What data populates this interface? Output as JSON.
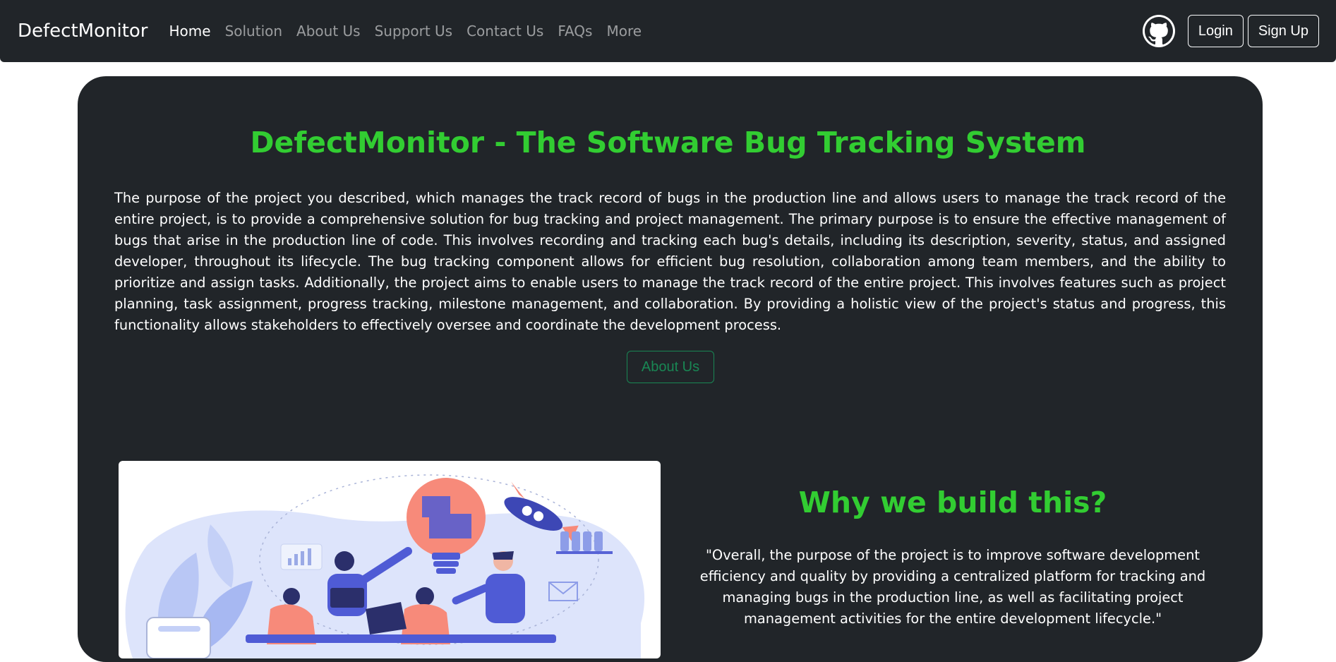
{
  "navbar": {
    "brand": "DefectMonitor",
    "links": [
      {
        "label": "Home",
        "active": true
      },
      {
        "label": "Solution",
        "active": false
      },
      {
        "label": "About Us",
        "active": false
      },
      {
        "label": "Support Us",
        "active": false
      },
      {
        "label": "Contact Us",
        "active": false
      },
      {
        "label": "FAQs",
        "active": false
      },
      {
        "label": "More",
        "active": false
      }
    ],
    "github_icon": "github-icon",
    "login_label": "Login",
    "signup_label": "Sign Up"
  },
  "hero": {
    "title": "DefectMonitor - The Software Bug Tracking System",
    "description": "The purpose of the project you described, which manages the track record of bugs in the production line and allows users to manage the track record of the entire project, is to provide a comprehensive solution for bug tracking and project management. The primary purpose is to ensure the effective management of bugs that arise in the production line of code. This involves recording and tracking each bug's details, including its description, severity, status, and assigned developer, throughout its lifecycle. The bug tracking component allows for efficient bug resolution, collaboration among team members, and the ability to prioritize and assign tasks. Additionally, the project aims to enable users to manage the track record of the entire project. This involves features such as project planning, task assignment, progress tracking, milestone management, and collaboration. By providing a holistic view of the project's status and progress, this functionality allows stakeholders to effectively oversee and coordinate the development process.",
    "about_button": "About Us"
  },
  "why": {
    "title": "Why we build this?",
    "quote": "\"Overall, the purpose of the project is to improve software development efficiency and quality by providing a centralized platform for tracking and managing bugs in the production line, as well as facilitating project management activities for the entire development lifecycle.\""
  },
  "colors": {
    "dark": "#212529",
    "accent_green": "#32cd32",
    "button_green": "#198754"
  }
}
